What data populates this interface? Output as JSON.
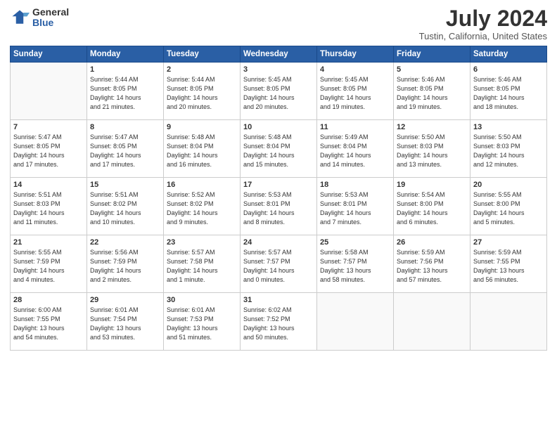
{
  "logo": {
    "general": "General",
    "blue": "Blue"
  },
  "title": "July 2024",
  "location": "Tustin, California, United States",
  "days_of_week": [
    "Sunday",
    "Monday",
    "Tuesday",
    "Wednesday",
    "Thursday",
    "Friday",
    "Saturday"
  ],
  "weeks": [
    [
      {
        "day": "",
        "info": ""
      },
      {
        "day": "1",
        "info": "Sunrise: 5:44 AM\nSunset: 8:05 PM\nDaylight: 14 hours\nand 21 minutes."
      },
      {
        "day": "2",
        "info": "Sunrise: 5:44 AM\nSunset: 8:05 PM\nDaylight: 14 hours\nand 20 minutes."
      },
      {
        "day": "3",
        "info": "Sunrise: 5:45 AM\nSunset: 8:05 PM\nDaylight: 14 hours\nand 20 minutes."
      },
      {
        "day": "4",
        "info": "Sunrise: 5:45 AM\nSunset: 8:05 PM\nDaylight: 14 hours\nand 19 minutes."
      },
      {
        "day": "5",
        "info": "Sunrise: 5:46 AM\nSunset: 8:05 PM\nDaylight: 14 hours\nand 19 minutes."
      },
      {
        "day": "6",
        "info": "Sunrise: 5:46 AM\nSunset: 8:05 PM\nDaylight: 14 hours\nand 18 minutes."
      }
    ],
    [
      {
        "day": "7",
        "info": "Sunrise: 5:47 AM\nSunset: 8:05 PM\nDaylight: 14 hours\nand 17 minutes."
      },
      {
        "day": "8",
        "info": "Sunrise: 5:47 AM\nSunset: 8:05 PM\nDaylight: 14 hours\nand 17 minutes."
      },
      {
        "day": "9",
        "info": "Sunrise: 5:48 AM\nSunset: 8:04 PM\nDaylight: 14 hours\nand 16 minutes."
      },
      {
        "day": "10",
        "info": "Sunrise: 5:48 AM\nSunset: 8:04 PM\nDaylight: 14 hours\nand 15 minutes."
      },
      {
        "day": "11",
        "info": "Sunrise: 5:49 AM\nSunset: 8:04 PM\nDaylight: 14 hours\nand 14 minutes."
      },
      {
        "day": "12",
        "info": "Sunrise: 5:50 AM\nSunset: 8:03 PM\nDaylight: 14 hours\nand 13 minutes."
      },
      {
        "day": "13",
        "info": "Sunrise: 5:50 AM\nSunset: 8:03 PM\nDaylight: 14 hours\nand 12 minutes."
      }
    ],
    [
      {
        "day": "14",
        "info": "Sunrise: 5:51 AM\nSunset: 8:03 PM\nDaylight: 14 hours\nand 11 minutes."
      },
      {
        "day": "15",
        "info": "Sunrise: 5:51 AM\nSunset: 8:02 PM\nDaylight: 14 hours\nand 10 minutes."
      },
      {
        "day": "16",
        "info": "Sunrise: 5:52 AM\nSunset: 8:02 PM\nDaylight: 14 hours\nand 9 minutes."
      },
      {
        "day": "17",
        "info": "Sunrise: 5:53 AM\nSunset: 8:01 PM\nDaylight: 14 hours\nand 8 minutes."
      },
      {
        "day": "18",
        "info": "Sunrise: 5:53 AM\nSunset: 8:01 PM\nDaylight: 14 hours\nand 7 minutes."
      },
      {
        "day": "19",
        "info": "Sunrise: 5:54 AM\nSunset: 8:00 PM\nDaylight: 14 hours\nand 6 minutes."
      },
      {
        "day": "20",
        "info": "Sunrise: 5:55 AM\nSunset: 8:00 PM\nDaylight: 14 hours\nand 5 minutes."
      }
    ],
    [
      {
        "day": "21",
        "info": "Sunrise: 5:55 AM\nSunset: 7:59 PM\nDaylight: 14 hours\nand 4 minutes."
      },
      {
        "day": "22",
        "info": "Sunrise: 5:56 AM\nSunset: 7:59 PM\nDaylight: 14 hours\nand 2 minutes."
      },
      {
        "day": "23",
        "info": "Sunrise: 5:57 AM\nSunset: 7:58 PM\nDaylight: 14 hours\nand 1 minute."
      },
      {
        "day": "24",
        "info": "Sunrise: 5:57 AM\nSunset: 7:57 PM\nDaylight: 14 hours\nand 0 minutes."
      },
      {
        "day": "25",
        "info": "Sunrise: 5:58 AM\nSunset: 7:57 PM\nDaylight: 13 hours\nand 58 minutes."
      },
      {
        "day": "26",
        "info": "Sunrise: 5:59 AM\nSunset: 7:56 PM\nDaylight: 13 hours\nand 57 minutes."
      },
      {
        "day": "27",
        "info": "Sunrise: 5:59 AM\nSunset: 7:55 PM\nDaylight: 13 hours\nand 56 minutes."
      }
    ],
    [
      {
        "day": "28",
        "info": "Sunrise: 6:00 AM\nSunset: 7:55 PM\nDaylight: 13 hours\nand 54 minutes."
      },
      {
        "day": "29",
        "info": "Sunrise: 6:01 AM\nSunset: 7:54 PM\nDaylight: 13 hours\nand 53 minutes."
      },
      {
        "day": "30",
        "info": "Sunrise: 6:01 AM\nSunset: 7:53 PM\nDaylight: 13 hours\nand 51 minutes."
      },
      {
        "day": "31",
        "info": "Sunrise: 6:02 AM\nSunset: 7:52 PM\nDaylight: 13 hours\nand 50 minutes."
      },
      {
        "day": "",
        "info": ""
      },
      {
        "day": "",
        "info": ""
      },
      {
        "day": "",
        "info": ""
      }
    ]
  ]
}
